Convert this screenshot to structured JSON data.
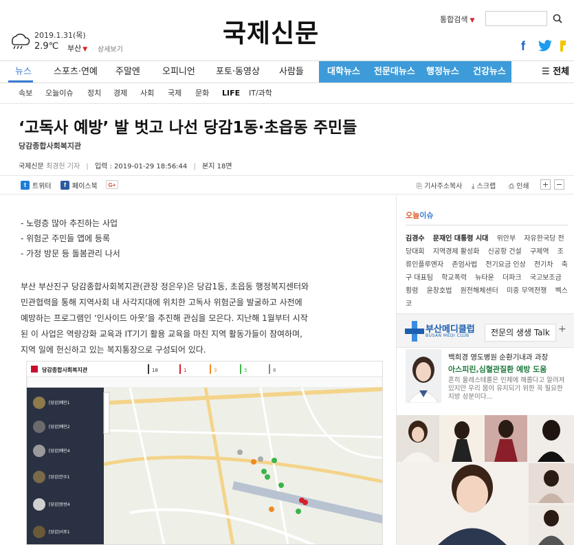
{
  "header": {
    "date": "2019.1.31(목)",
    "temperature": "2.9℃",
    "region": "부산",
    "detail_link": "상세보기",
    "logo": "국제신문",
    "search_select": "통합검색",
    "search_placeholder": ""
  },
  "gnb": {
    "items": [
      "뉴스",
      "스포츠·연예",
      "주말엔",
      "오피니언",
      "포토·동영상",
      "사람들"
    ],
    "blue_items": [
      "대학뉴스",
      "전문대뉴스",
      "행정뉴스",
      "건강뉴스"
    ],
    "all_label": "전체",
    "active_color": "#3a7bd5",
    "blue_color": "#3d9bd9"
  },
  "subnav": {
    "items": [
      "속보",
      "오늘이슈",
      "정치",
      "경제",
      "사회",
      "국제",
      "문화",
      "LIFE",
      "IT/과학"
    ]
  },
  "article": {
    "headline": "‘고독사 예방’ 발 벗고 나선 당감1동·초읍동 주민들",
    "subhead": "당감종합사회복지관",
    "source": "국제신문",
    "reporter": "최경헌 기자",
    "published": "입력 : 2019-01-29 18:56:44",
    "views": "본지 18면",
    "bullets": [
      "- 노령층 많아 추진하는 사업",
      "- 위험군 주민들 앱에 등록",
      "- 가정 방문 등 돌봄관리 나서"
    ],
    "body_lines": [
      "부산 부산진구 당감종합사회복지관(관장 정은우)은 당감1동, 초읍동 행정복지센터와",
      "민관협력을 통해 지역사회 내 사각지대에 위치한 고독사 위험군을 발굴하고 사전에",
      "예방하는 프로그램인 ‘인사이드 아웃’을 추진해 관심을 모은다. 지난해 1월부터 시작",
      "된 이 사업은 역량강화 교육과 IT기기 활용 교육을 마친 지역 활동가들이 참여하며,",
      "지역 일에 헌신하고 있는 복지통장으로 구성되어 있다."
    ]
  },
  "share": {
    "twitter": "트위터",
    "facebook": "페이스북",
    "google_plus": "G+",
    "copy_url": "기사주소복사",
    "scrap": "스크랩",
    "print": "인쇄",
    "zoom_in": "+",
    "zoom_out": "−"
  },
  "map_image": {
    "org_title": "당감종합사회복지관",
    "counts": [
      "18",
      "1",
      "3",
      "5",
      "8"
    ],
    "list_items": [
      "[당감]메인1",
      "[당감]메인2",
      "[당감]메인4",
      "[당감]잔수1",
      "[당감]동방4",
      "[당감]서포1"
    ]
  },
  "sidebar": {
    "issue_title_prefix": "오늘",
    "issue_title_suffix": "이슈",
    "issues": [
      {
        "text": "김경수",
        "bold": true
      },
      {
        "text": "문재인 대통령 시대",
        "bold": true
      },
      {
        "text": "위안부",
        "bold": false
      },
      {
        "text": "자유한국당 전당대회",
        "bold": false
      },
      {
        "text": "지역경제 활성화",
        "bold": false
      },
      {
        "text": "신공항 건설",
        "bold": false
      },
      {
        "text": "구제역",
        "bold": false
      },
      {
        "text": "조류인플루엔자",
        "bold": false
      },
      {
        "text": "존엄사법",
        "bold": false
      },
      {
        "text": "전기요금 인상",
        "bold": false
      },
      {
        "text": "전기차",
        "bold": false
      },
      {
        "text": "축구 대표팀",
        "bold": false
      },
      {
        "text": "학교폭력",
        "bold": false
      },
      {
        "text": "뉴타운",
        "bold": false
      },
      {
        "text": "더파크",
        "bold": false
      },
      {
        "text": "국고보조금 횡령",
        "bold": false
      },
      {
        "text": "윤창호법",
        "bold": false
      },
      {
        "text": "원전해체센터",
        "bold": false
      },
      {
        "text": "미중 무역전쟁",
        "bold": false
      },
      {
        "text": "벡스코",
        "bold": false
      }
    ],
    "medi_name": "부산메디클럽",
    "medi_sub": "BUSAN MEDI CLUB",
    "medi_tab": "전문의 생생 Talk",
    "medi_plus": "+",
    "talk_name": "백희경 영도병원 순환기내과 과장",
    "talk_title": "아스피린,심혈관질환 예방 도움",
    "talk_desc": "흔히 울레스테롤은 인체에 해롭다고 알려져 있지만 우리 몸이 유지되기 위한 꼭 필요한 지방 성분이다..."
  }
}
